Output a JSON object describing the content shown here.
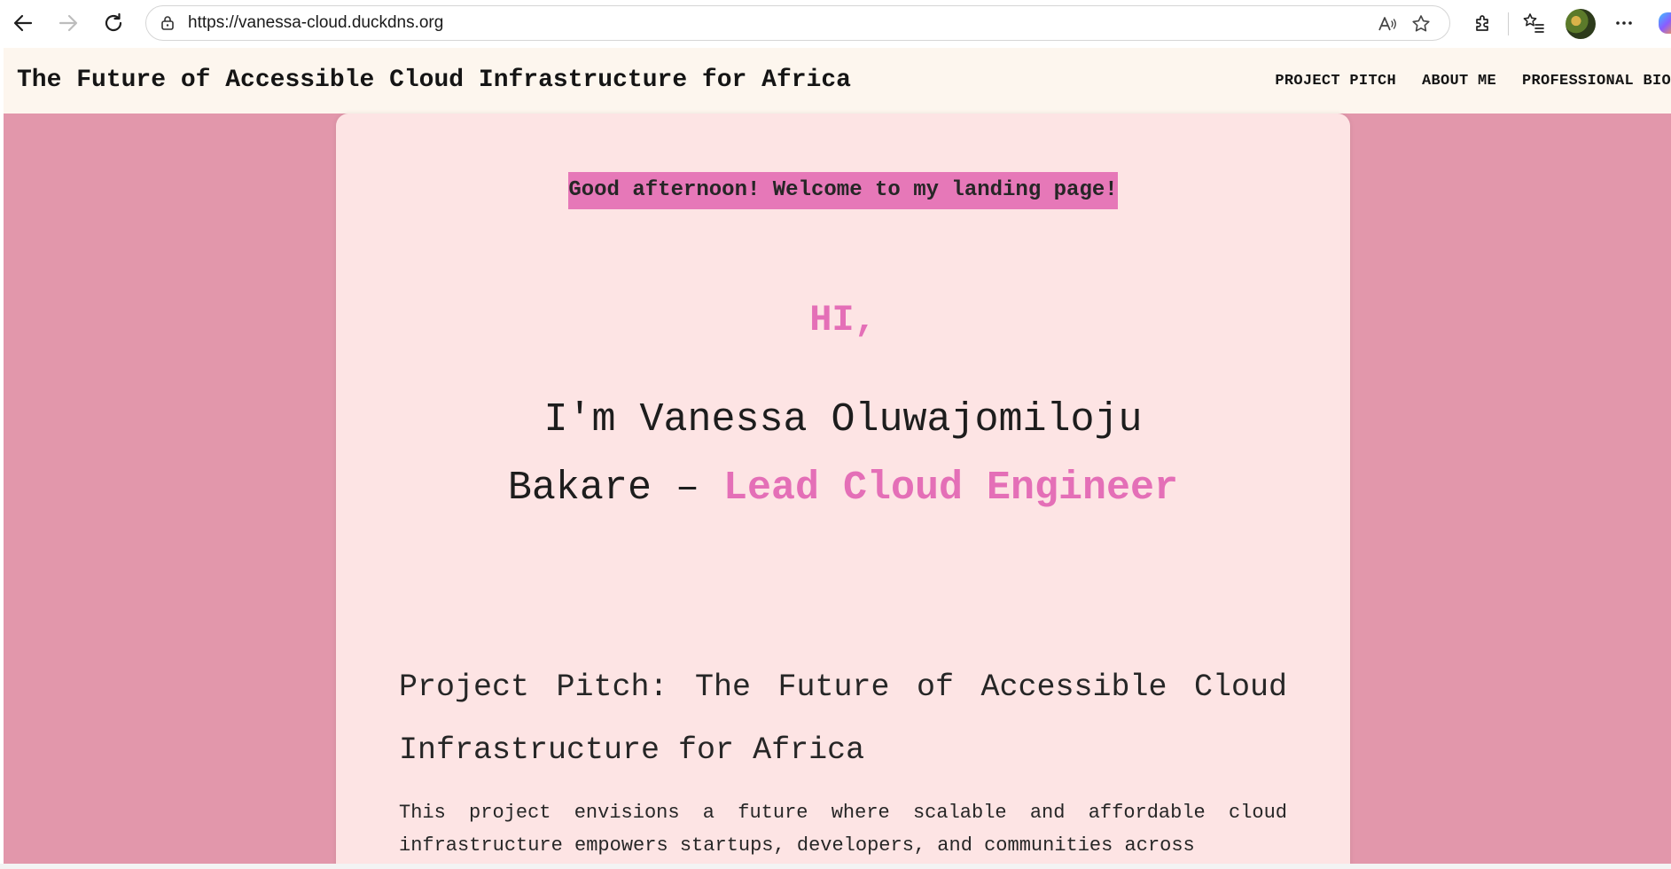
{
  "browser": {
    "url": "https://vanessa-cloud.duckdns.org",
    "icons": [
      "back-arrow-icon",
      "forward-arrow-icon",
      "refresh-icon",
      "site-info-lock-icon",
      "read-aloud-icon",
      "favorite-star-icon",
      "extensions-puzzle-icon",
      "favorites-list-icon",
      "profile-avatar",
      "more-menu-icon",
      "copilot-icon"
    ]
  },
  "site": {
    "title": "The Future of Accessible Cloud Infrastructure for Africa",
    "nav": [
      "PROJECT PITCH",
      "ABOUT ME",
      "PROFESSIONAL BIO"
    ]
  },
  "hero": {
    "greeting": "Good afternoon! Welcome to my landing page!",
    "hi": "HI,",
    "intro_prefix": "I'm Vanessa Oluwajomiloju Bakare – ",
    "role": "Lead Cloud Engineer"
  },
  "pitch": {
    "heading": "Project Pitch: The Future of Accessible Cloud Infrastructure for Africa",
    "body": "This project envisions a future where scalable and affordable cloud infrastructure empowers startups, developers, and communities across"
  },
  "colors": {
    "page_background": "#e297ab",
    "card_background": "#fde4e4",
    "header_background": "#fdf6ee",
    "accent_pink": "#e46fb7",
    "greeting_highlight": "#e678b8"
  }
}
